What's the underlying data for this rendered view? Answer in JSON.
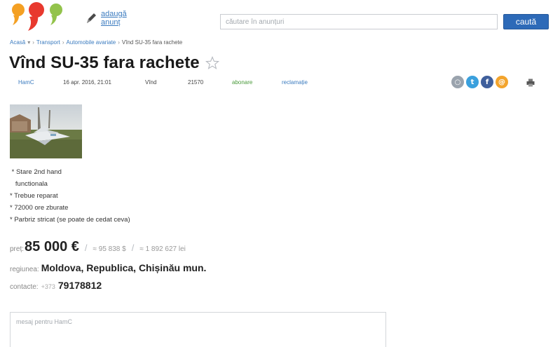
{
  "header": {
    "add_ad_label": "adaugă\nanunț",
    "search_placeholder": "căutare în anunțuri",
    "search_button": "caută"
  },
  "breadcrumb": {
    "home": "Acasă",
    "transport": "Transport",
    "category": "Automobile avariate",
    "current": "Vînd SU-35 fara rachete"
  },
  "ad": {
    "title": "Vînd SU-35 fara rachete",
    "author": "HamC",
    "date": "16 apr. 2016, 21:01",
    "type": "Vînd",
    "views": "21570",
    "subscribe": "abonare",
    "complaint": "reclamație",
    "description": [
      " * Stare 2nd hand",
      "   functionala",
      "* Trebue reparat",
      "* 72000 ore zburate",
      "* Parbriz stricat (se poate de cedat ceva)"
    ],
    "price_label": "preț:",
    "price": "85 000 €",
    "price_usd": "≈ 95 838 $",
    "price_lei": "≈ 1 892 627 lei",
    "region_label": "regiunea:",
    "region": "Moldova, Republica, Chișinău mun.",
    "contact_label": "contacte:",
    "phone_prefix": "+373",
    "phone": "79178812",
    "message_placeholder": "mesaj pentru HamC"
  },
  "colors": {
    "accent": "#2d6ab8",
    "link": "#3b7bbf",
    "subscribe": "#4a9a3b",
    "logo_orange": "#f4a023",
    "logo_red": "#e8392e",
    "logo_green": "#93c34b"
  },
  "share_icons": [
    "odnoklassniki-icon",
    "twitter-icon",
    "facebook-icon",
    "mail-icon"
  ]
}
